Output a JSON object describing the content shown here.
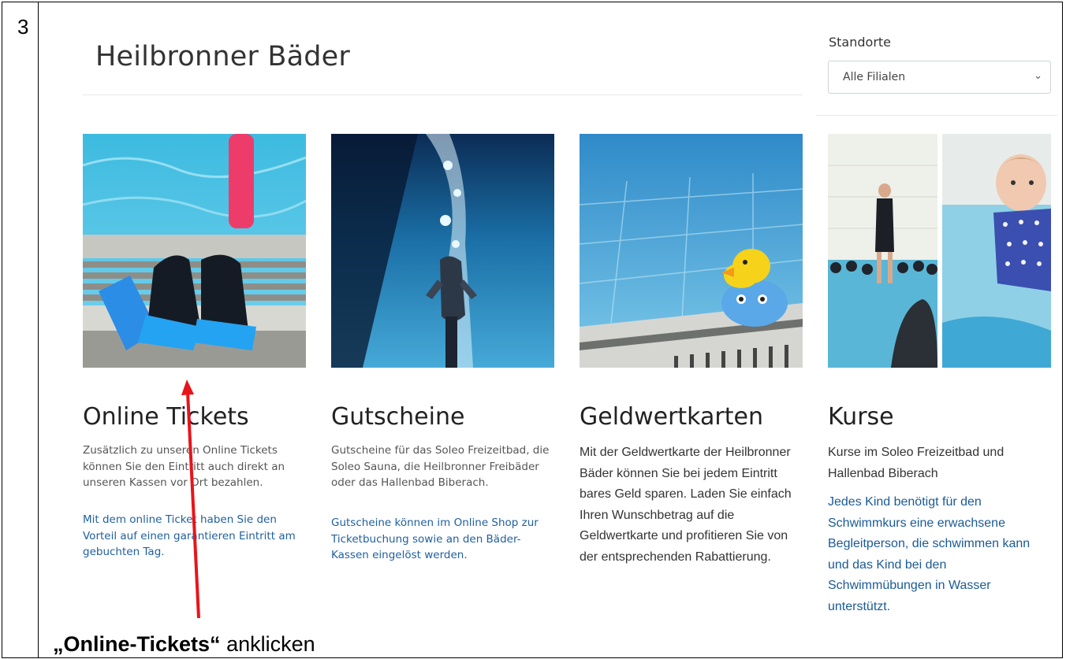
{
  "step": {
    "number": "3"
  },
  "header": {
    "title": "Heilbronner Bäder"
  },
  "locations": {
    "label": "Standorte",
    "selected": "Alle Filialen"
  },
  "cards": [
    {
      "image": "swim-fins-photo",
      "title": "Online Tickets",
      "text": "Zusätzlich zu unseren Online Tickets können Sie den Eintritt auch direkt an unseren Kassen vor Ort bezahlen.",
      "text2": "Mit dem online Ticket haben Sie den Vorteil auf einen garantieren Eintritt am gebuchten Tag."
    },
    {
      "image": "underwater-diver-photo",
      "title": "Gutscheine",
      "text": "Gutscheine für das Soleo Freizeitbad, die Soleo Sauna, die Heilbronner Freibäder oder das Hallenbad Biberach.",
      "text2": "Gutscheine können im Online Shop zur Ticketbuchung sowie an den Bäder-Kassen eingelöst werden."
    },
    {
      "image": "rubber-duck-photo",
      "title": "Geldwertkarten",
      "text": "Mit der Geldwertkarte der Heilbronner Bäder können Sie bei jedem Eintritt bares Geld sparen. Laden Sie einfach Ihren Wunschbetrag auf die Geldwertkarte und profitieren Sie von der entsprechenden Rabattierung."
    },
    {
      "image": "swim-course-photos",
      "title": "Kurse",
      "text": "Kurse im Soleo Freizeitbad und Hallenbad Biberach",
      "text2": "Jedes Kind benötigt für den Schwimmkurs eine erwachsene Begleitperson, die schwimmen kann und das Kind bei den Schwimmübungen in Wasser unterstützt."
    }
  ],
  "annotation": {
    "bold": "„Online-Tickets“",
    "rest": " anklicken"
  },
  "colors": {
    "arrow": "#e8141b",
    "link": "#1f5f9e"
  }
}
